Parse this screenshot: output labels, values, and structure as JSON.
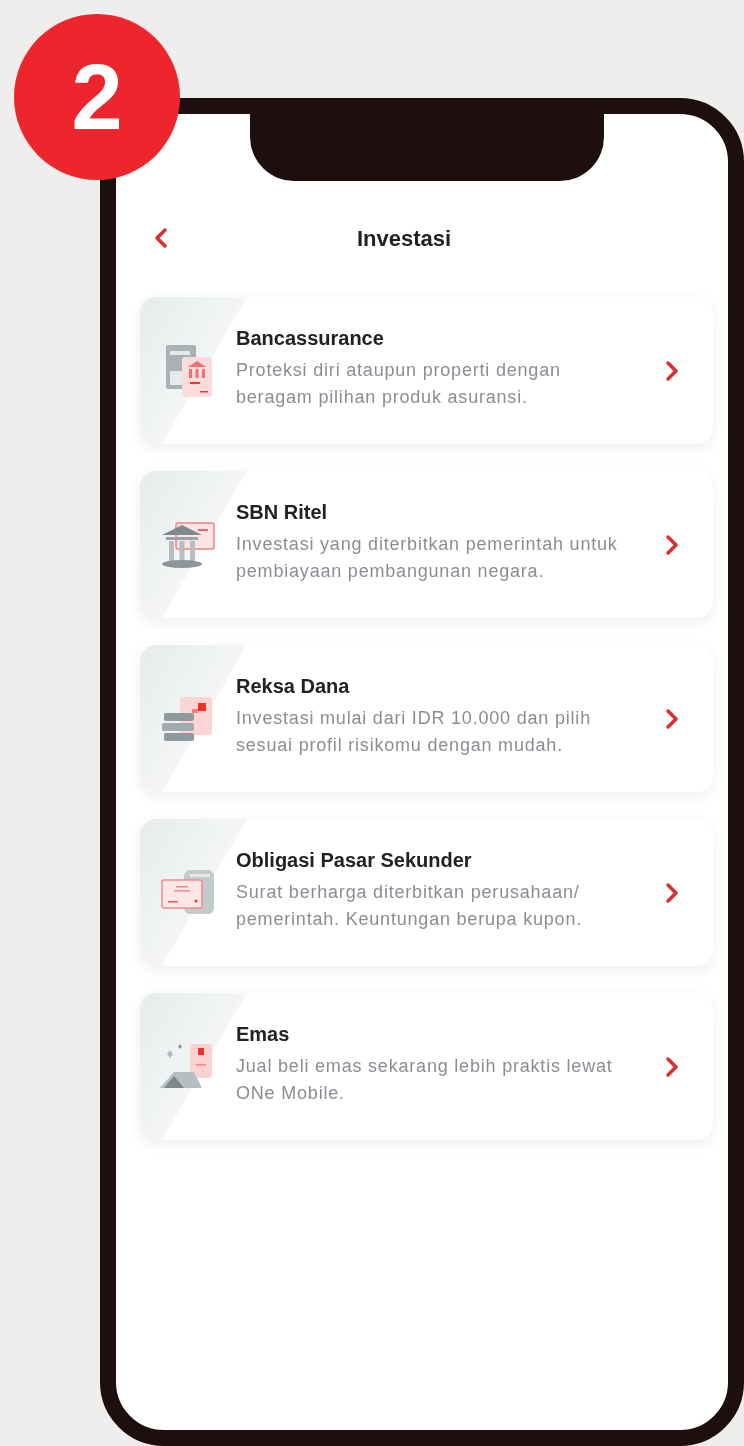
{
  "step_badge": "2",
  "header": {
    "title": "Investasi"
  },
  "items": [
    {
      "title": "Bancassurance",
      "description": "Proteksi diri ataupun properti dengan beragam pilihan produk asuransi."
    },
    {
      "title": "SBN Ritel",
      "description": "Investasi yang diterbitkan pemerintah untuk pembiayaan pembangunan negara."
    },
    {
      "title": "Reksa Dana",
      "description": "Investasi mulai dari IDR 10.000 dan pilih sesuai profil risikomu dengan mudah."
    },
    {
      "title": "Obligasi Pasar Sekunder",
      "description": "Surat berharga diterbitkan perusahaan/ pemerintah. Keuntungan berupa kupon."
    },
    {
      "title": "Emas",
      "description": "Jual beli emas sekarang lebih praktis lewat ONe Mobile."
    }
  ]
}
